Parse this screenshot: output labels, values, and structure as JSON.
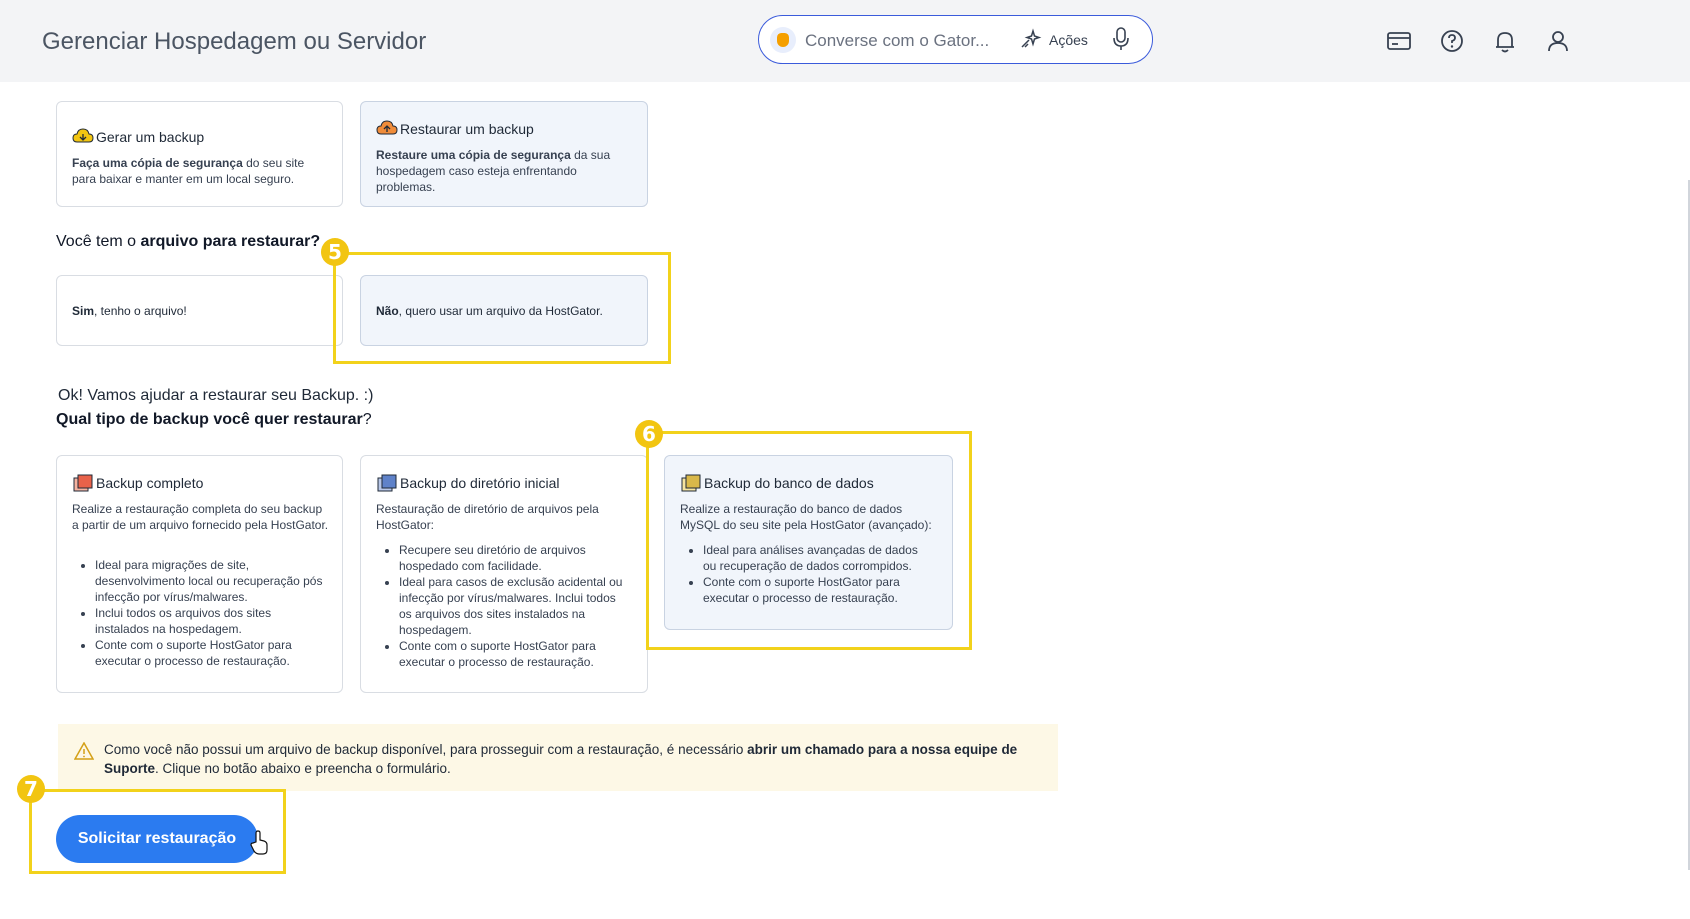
{
  "header": {
    "title": "Gerenciar Hospedagem ou Servidor",
    "chat_placeholder": "Converse com o Gator...",
    "actions_label": "Ações"
  },
  "backup_options": [
    {
      "title": "Gerar um backup",
      "desc_bold": "Faça uma cópia de segurança",
      "desc_rest": " do seu site para baixar e manter em um local seguro."
    },
    {
      "title": "Restaurar um backup",
      "desc_bold": "Restaure uma cópia de segurança",
      "desc_rest": " da sua hospedagem caso esteja enfrentando problemas."
    }
  ],
  "file_question": {
    "prefix": "Você tem o ",
    "bold": "arquivo para restaurar?"
  },
  "file_options": [
    {
      "bold": "Sim",
      "rest": ", tenho o arquivo!"
    },
    {
      "bold": "Não",
      "rest": ", quero usar um arquivo da HostGator."
    }
  ],
  "ok_message": "Ok! Vamos ajudar a restaurar seu Backup. :)",
  "type_question": {
    "bold": "Qual tipo de backup você quer restaurar",
    "suffix": "?"
  },
  "backup_types": [
    {
      "title": "Backup completo",
      "desc": "Realize a restauração completa do seu backup a partir de um arquivo fornecido pela HostGator.",
      "bullets": [
        "Ideal para migrações de site, desenvolvimento local ou recuperação pós infecção por vírus/malwares.",
        "Inclui todos os arquivos dos sites instalados na hospedagem.",
        "Conte com o suporte HostGator para executar o processo de restauração."
      ]
    },
    {
      "title": "Backup do diretório inicial",
      "desc": "Restauração de diretório de arquivos pela HostGator:",
      "bullets": [
        "Recupere seu diretório de arquivos hospedado com facilidade.",
        "Ideal para casos de exclusão acidental ou infecção por vírus/malwares. Inclui todos os arquivos dos sites instalados na hospedagem.",
        "Conte com o suporte HostGator para executar o processo de restauração."
      ]
    },
    {
      "title": "Backup do banco de dados",
      "desc": "Realize a restauração do banco de dados MySQL do seu site pela HostGator (avançado):",
      "bullets": [
        "Ideal para análises avançadas de dados ou recuperação de dados corrompidos.",
        "Conte com o suporte HostGator para executar o processo de restauração."
      ]
    }
  ],
  "alert": {
    "text_1": "Como você não possui um arquivo de backup disponível, para prosseguir com a restauração, é necessário ",
    "bold": "abrir um chamado para a nossa equipe de Suporte",
    "text_2": ". Clique no botão abaixo e preencha o formulário."
  },
  "submit_label": "Solicitar restauração",
  "step_badges": [
    "5",
    "6",
    "7"
  ],
  "colors": {
    "highlight": "#f2d21b",
    "primary": "#2b7bf0",
    "alert_bg": "#fdf8e6"
  }
}
